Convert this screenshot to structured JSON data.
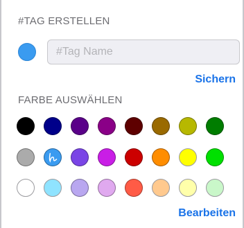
{
  "create_section": {
    "title": "#TAG ERSTELLEN",
    "selected_color": "#3a9bf0",
    "input": {
      "placeholder": "#Tag Name",
      "value": ""
    },
    "save_label": "Sichern"
  },
  "color_section": {
    "title": "FARBE AUSWÄHLEN",
    "selected_swatch": "blue",
    "edit_label": "Bearbeiten",
    "rows": [
      [
        "#000000",
        "#00008a",
        "#5a0089",
        "#8a0087",
        "#5e0000",
        "#9a6a00",
        "#b7b800",
        "#007d00"
      ],
      [
        "#ababab",
        "#3a9bf0",
        "#7a45e6",
        "#c91ee6",
        "#cc0000",
        "#ff8d00",
        "#ffff00",
        "#00e000"
      ],
      [
        "#ffffff",
        "#8fe3ff",
        "#b9a7f0",
        "#e0a9ef",
        "#ff5b46",
        "#ffc98e",
        "#ffffaa",
        "#c9f7c9"
      ]
    ]
  }
}
